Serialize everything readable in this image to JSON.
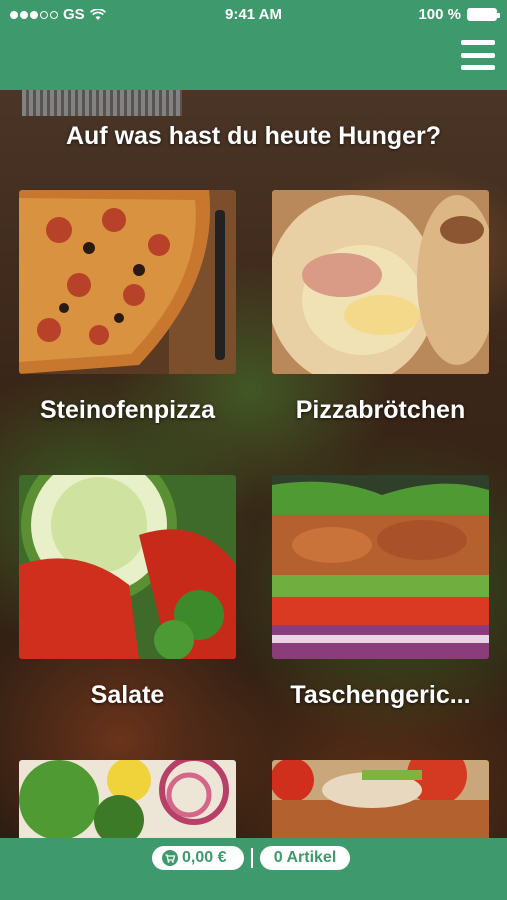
{
  "status_bar": {
    "carrier": "GS",
    "time": "9:41 AM",
    "battery": "100 %"
  },
  "header": {
    "menu_icon": "hamburger-menu-icon"
  },
  "headline": "Auf was hast du heute Hunger?",
  "categories": [
    {
      "label": "Steinofenpizza",
      "image": "pizza-photo"
    },
    {
      "label": "Pizzabrötchen",
      "image": "pizza-roll-photo"
    },
    {
      "label": "Salate",
      "image": "salad-photo"
    },
    {
      "label": "Taschengeric...",
      "image": "kebab-photo"
    },
    {
      "label": "",
      "image": "salad-plate-photo"
    },
    {
      "label": "",
      "image": "wrap-photo"
    }
  ],
  "cart": {
    "total": "0,00 €",
    "items": "0 Artikel",
    "cart_icon": "cart-icon"
  },
  "colors": {
    "brand_green": "#3e9a6c",
    "text": "#ffffff"
  }
}
